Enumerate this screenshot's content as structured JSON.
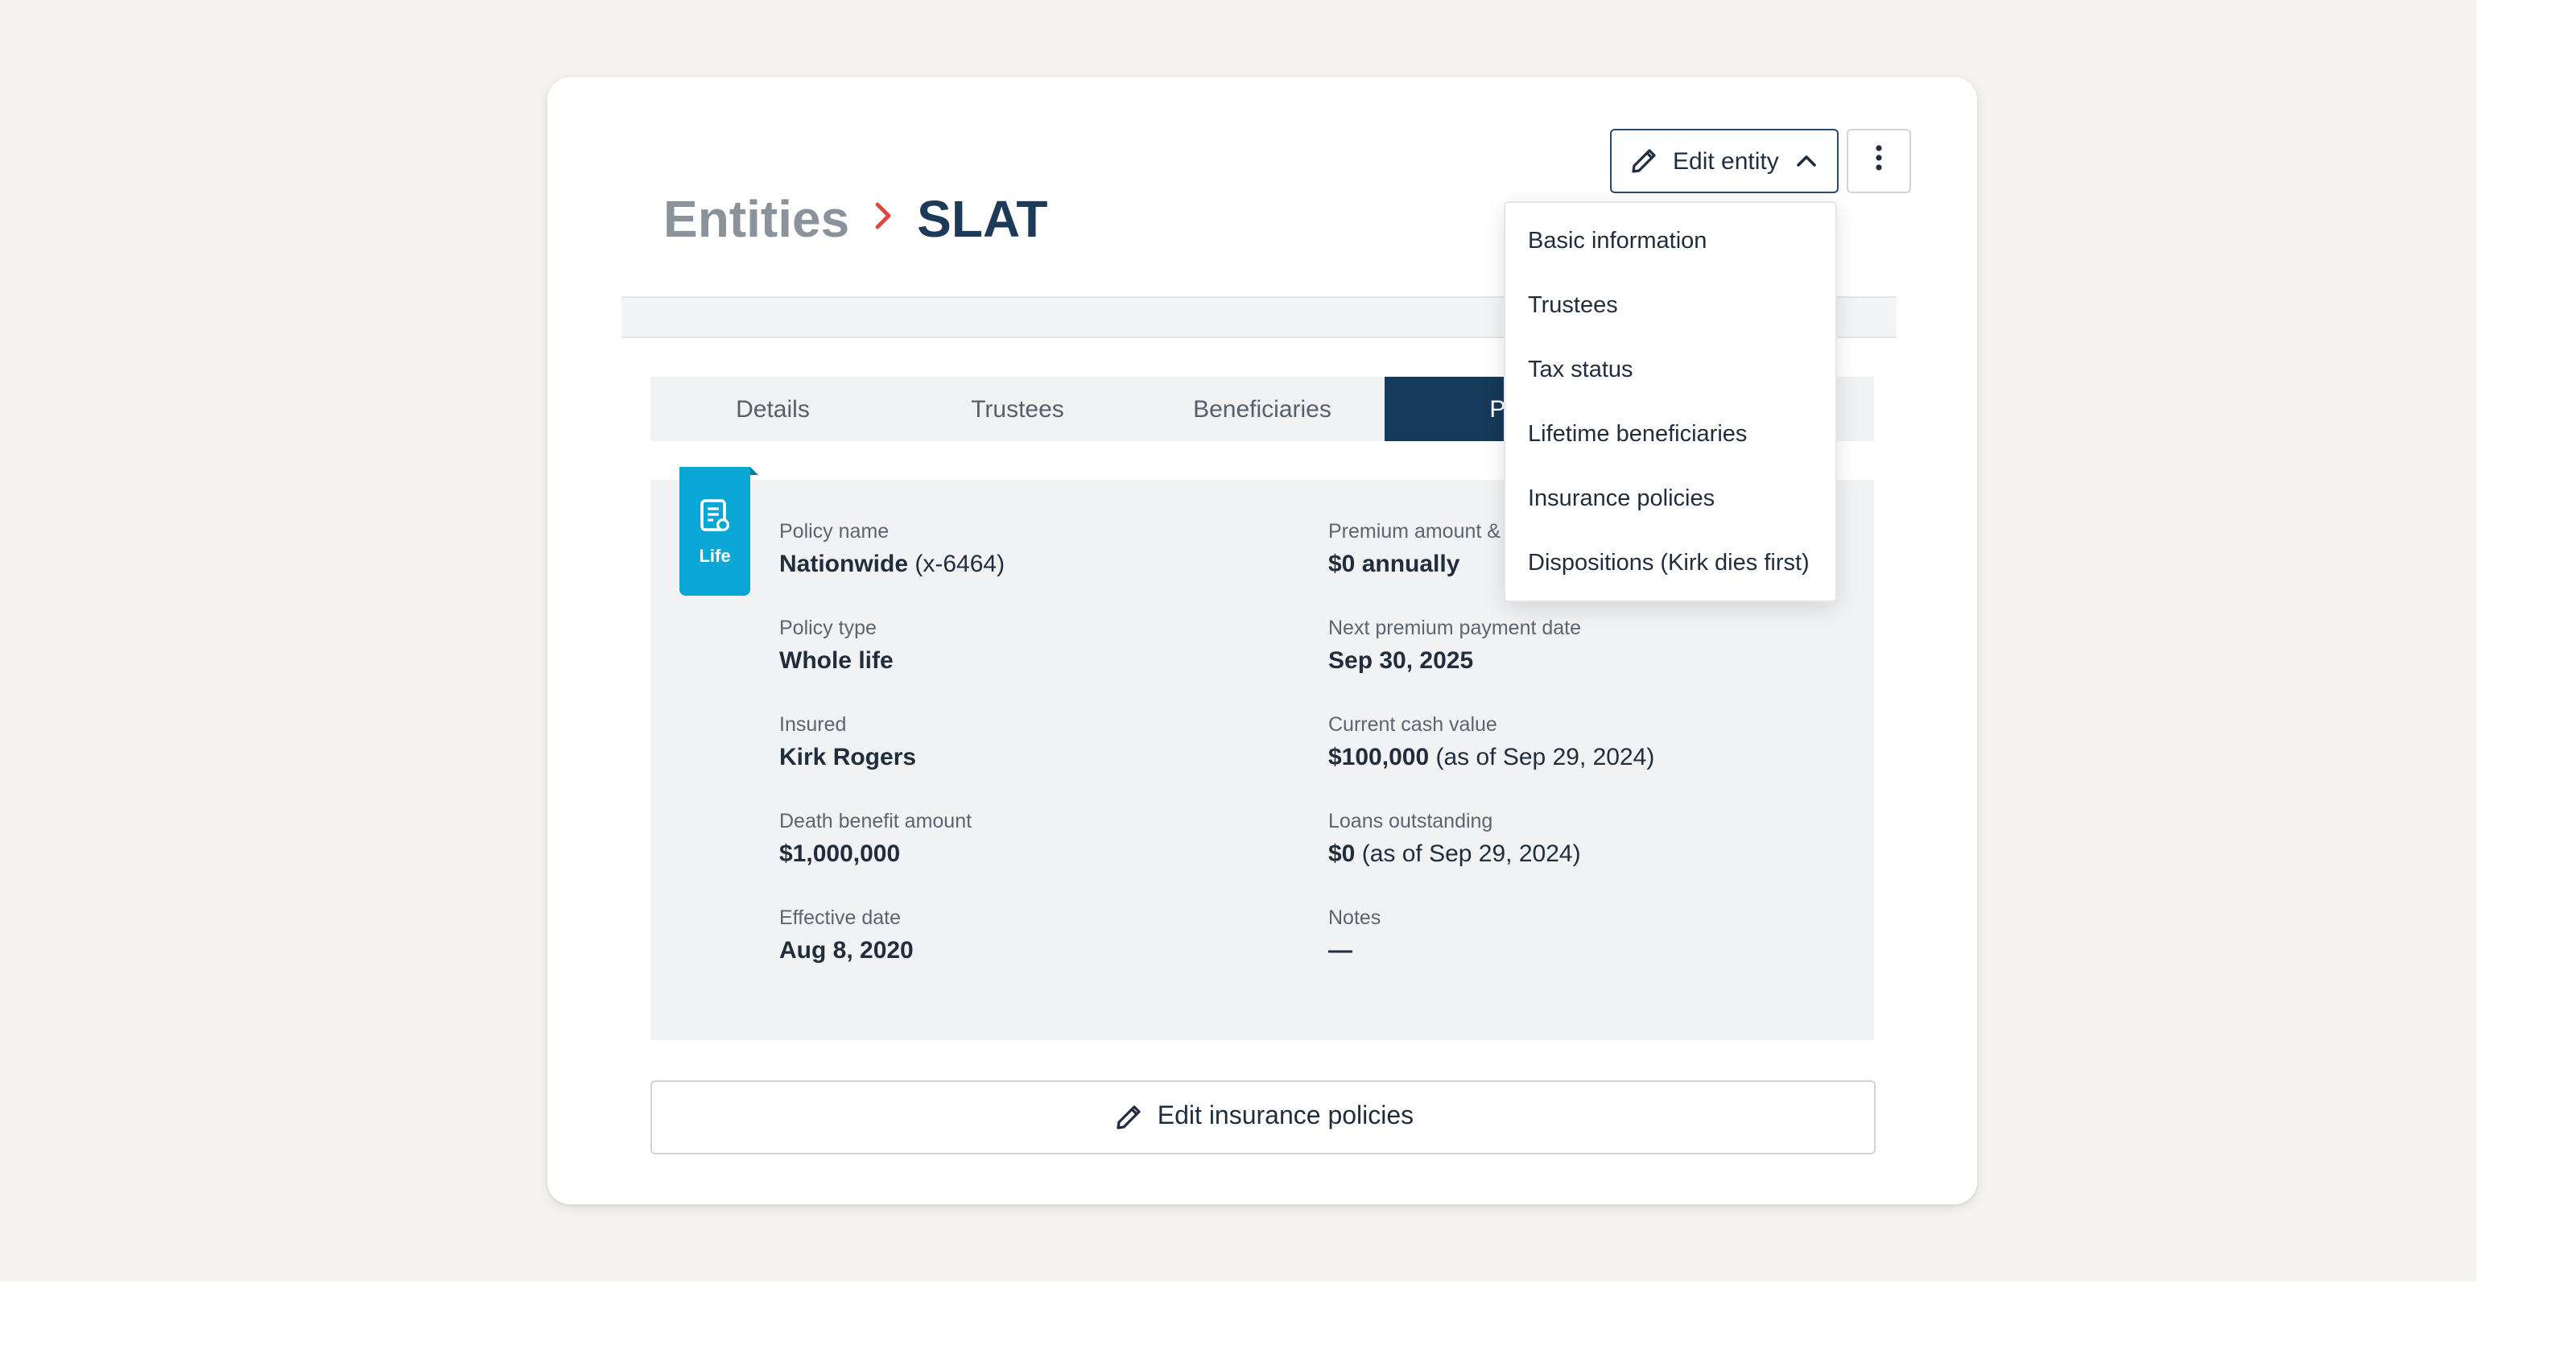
{
  "breadcrumb": {
    "parent": "Entities",
    "current": "SLAT"
  },
  "header": {
    "edit_entity_label": "Edit entity"
  },
  "tabs": [
    {
      "label": "Details"
    },
    {
      "label": "Trustees"
    },
    {
      "label": "Beneficiaries"
    },
    {
      "label": "Pol"
    }
  ],
  "policy": {
    "badge_label": "Life",
    "left_fields": [
      {
        "label": "Policy name",
        "value_bold": "Nationwide",
        "value_rest": " (x-6464)"
      },
      {
        "label": "Policy type",
        "value_bold": "Whole life",
        "value_rest": ""
      },
      {
        "label": "Insured",
        "value_bold": "Kirk Rogers",
        "value_rest": ""
      },
      {
        "label": "Death benefit amount",
        "value_bold": "$1,000,000",
        "value_rest": ""
      },
      {
        "label": "Effective date",
        "value_bold": "Aug 8, 2020",
        "value_rest": ""
      }
    ],
    "right_fields": [
      {
        "label": "Premium amount &",
        "value_bold": "$0 annually",
        "value_rest": ""
      },
      {
        "label": "Next premium payment date",
        "value_bold": "Sep 30, 2025",
        "value_rest": ""
      },
      {
        "label": "Current cash value",
        "value_bold": "$100,000",
        "value_rest": " (as of Sep 29, 2024)"
      },
      {
        "label": "Loans outstanding",
        "value_bold": "$0",
        "value_rest": " (as of Sep 29, 2024)"
      },
      {
        "label": "Notes",
        "value_bold": "—",
        "value_rest": ""
      }
    ]
  },
  "footer": {
    "edit_policies_label": "Edit insurance policies"
  },
  "dropdown": {
    "items": [
      {
        "label": "Basic information"
      },
      {
        "label": "Trustees"
      },
      {
        "label": "Tax status"
      },
      {
        "label": "Lifetime beneficiaries"
      },
      {
        "label": "Insurance policies"
      },
      {
        "label": "Dispositions (Kirk dies first)"
      }
    ]
  },
  "colors": {
    "accent_navy": "#163a59",
    "breadcrumb_chevron": "#e0463a",
    "life_badge": "#0aa6d6",
    "page_background": "#f5f4f1"
  }
}
